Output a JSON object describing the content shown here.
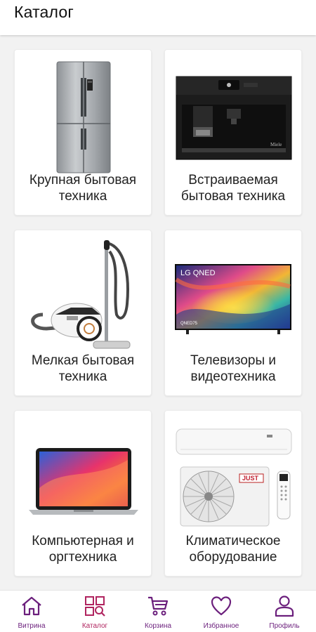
{
  "header": {
    "title": "Каталог"
  },
  "categories": [
    {
      "label": "Крупная бытовая\nтехника",
      "icon": "refrigerator"
    },
    {
      "label": "Встраиваемая\nбытовая техника",
      "icon": "built-in-coffee-machine"
    },
    {
      "label": "Мелкая бытовая\nтехника",
      "icon": "vacuum-cleaner"
    },
    {
      "label": "Телевизоры и\nвидеотехника",
      "icon": "tv"
    },
    {
      "label": "Компьютерная и\nоргтехника",
      "icon": "laptop"
    },
    {
      "label": "Климатическое\nоборудование",
      "icon": "air-conditioner"
    }
  ],
  "tv_brand": "LG QNED",
  "tv_model": "QNED75",
  "coffee_brand": "Miele",
  "ac_brand": "JUST",
  "nav": [
    {
      "label": "Витрина",
      "icon": "home-icon",
      "active": false
    },
    {
      "label": "Каталог",
      "icon": "catalog-icon",
      "active": true
    },
    {
      "label": "Корзина",
      "icon": "cart-icon",
      "active": false
    },
    {
      "label": "Избранное",
      "icon": "heart-icon",
      "active": false
    },
    {
      "label": "Профиль",
      "icon": "profile-icon",
      "active": false
    }
  ],
  "colors": {
    "nav_primary": "#6b1f7c",
    "nav_active": "#b0245f",
    "background": "#f2f2f2"
  }
}
